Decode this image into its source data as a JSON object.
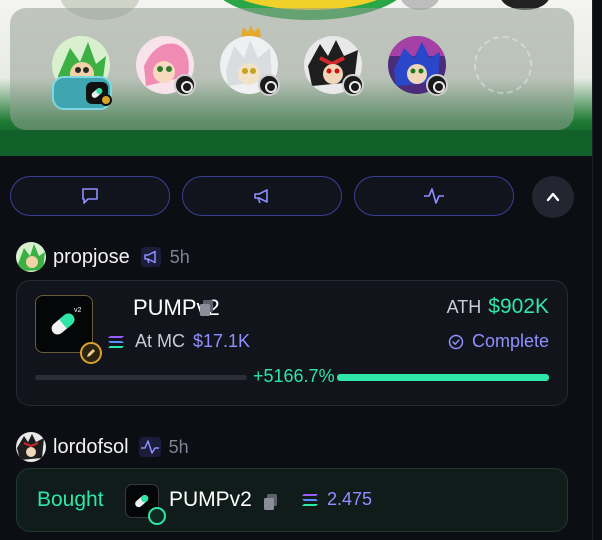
{
  "avatars": {
    "slots": [
      {
        "name": "green-hedgehog",
        "color": "#3cb043"
      },
      {
        "name": "pink-hedgehog",
        "color": "#f08bb4"
      },
      {
        "name": "silver-hedgehog",
        "color": "#d9dde0"
      },
      {
        "name": "black-hedgehog",
        "color": "#1e1e1e"
      },
      {
        "name": "blue-hedgehog",
        "color": "#2a46c9"
      }
    ],
    "crown_icon": "crown-icon",
    "empty_slot_icon": "add-slot-icon"
  },
  "tabs": [
    {
      "icon": "chat-icon"
    },
    {
      "icon": "megaphone-icon"
    },
    {
      "icon": "activity-icon"
    }
  ],
  "scroll_up_icon": "chevron-up-icon",
  "feed": [
    {
      "user": "propjose",
      "type_icon": "megaphone-icon",
      "time": "5h",
      "token": {
        "name": "PUMPv2",
        "mc_label": "At MC",
        "mc_value": "$17.1K",
        "ath_label": "ATH",
        "ath_value": "$902K",
        "status": "Complete",
        "change": "+5166.7%",
        "progress": 1.0
      }
    },
    {
      "user": "lordofsol",
      "type_icon": "activity-icon",
      "time": "5h",
      "trade": {
        "action": "Bought",
        "token": "PUMPv2",
        "amount": "2.475"
      }
    }
  ],
  "colors": {
    "accent_green": "#2ee6a8",
    "accent_purple": "#8f90ff",
    "tab_border": "#3b3f92"
  }
}
